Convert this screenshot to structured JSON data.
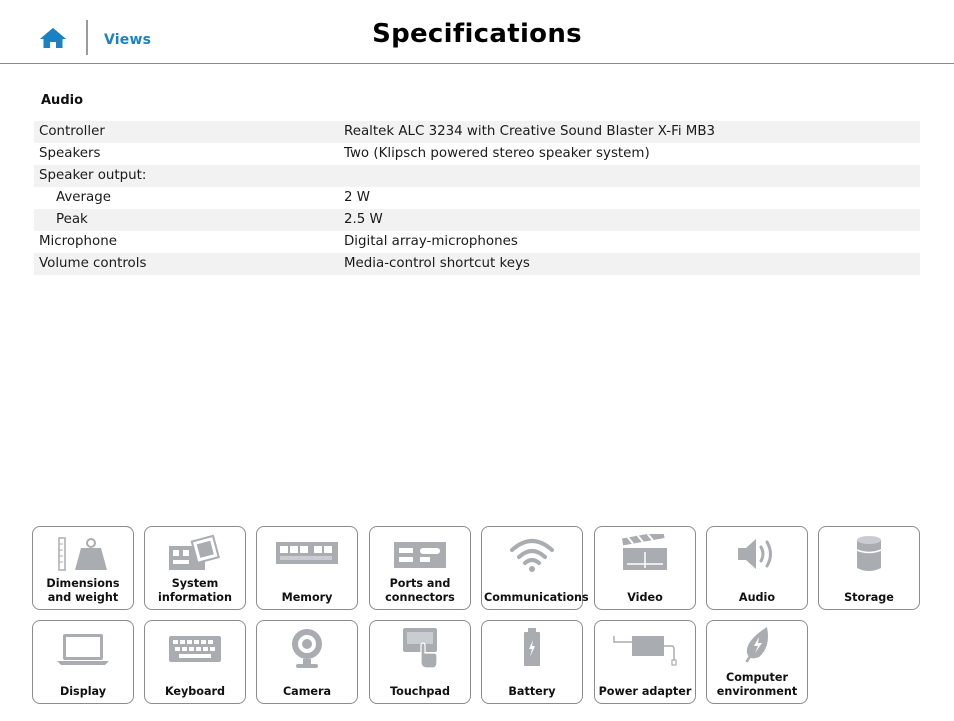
{
  "header": {
    "home_icon": "home-icon",
    "views_label": "Views",
    "title": "Specifications",
    "accent_color": "#1a82c4"
  },
  "section": {
    "title": "Audio"
  },
  "specs": [
    {
      "key": "Controller",
      "value": "Realtek ALC 3234 with Creative Sound Blaster X-Fi MB3"
    },
    {
      "key": "Speakers",
      "value": "Two (Klipsch powered stereo speaker system)"
    },
    {
      "key": "Speaker output:",
      "value": ""
    },
    {
      "key": "Average",
      "value": "2 W"
    },
    {
      "key": "Peak",
      "value": "2.5 W"
    },
    {
      "key": "Microphone",
      "value": "Digital array-microphones"
    },
    {
      "key": "Volume controls",
      "value": "Media-control shortcut keys"
    }
  ],
  "tiles": [
    {
      "label": "Dimensions and weight",
      "icon": "dimensions-weight-icon"
    },
    {
      "label": "System information",
      "icon": "system-board-icon"
    },
    {
      "label": "Memory",
      "icon": "memory-module-icon"
    },
    {
      "label": "Ports and connectors",
      "icon": "ports-icon"
    },
    {
      "label": "Communications",
      "icon": "wifi-icon"
    },
    {
      "label": "Video",
      "icon": "clapperboard-icon"
    },
    {
      "label": "Audio",
      "icon": "speaker-icon"
    },
    {
      "label": "Storage",
      "icon": "storage-drive-icon"
    },
    {
      "label": "Display",
      "icon": "laptop-display-icon"
    },
    {
      "label": "Keyboard",
      "icon": "keyboard-icon"
    },
    {
      "label": "Camera",
      "icon": "webcam-icon"
    },
    {
      "label": "Touchpad",
      "icon": "touchpad-icon"
    },
    {
      "label": "Battery",
      "icon": "battery-icon"
    },
    {
      "label": "Power adapter",
      "icon": "power-adapter-icon"
    },
    {
      "label": "Computer environment",
      "icon": "leaf-icon"
    }
  ]
}
